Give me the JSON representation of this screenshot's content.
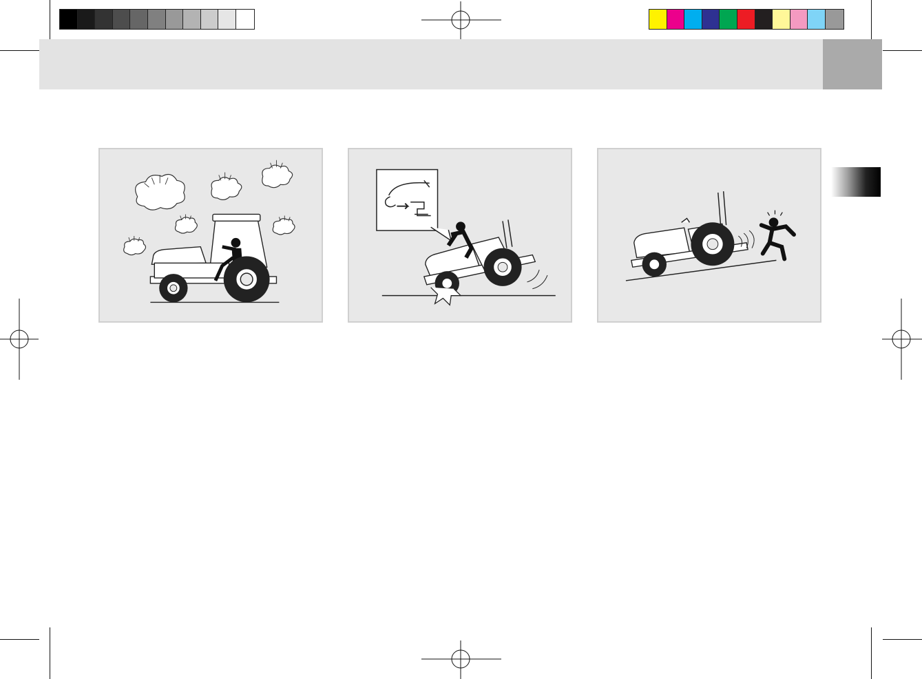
{
  "registration": {
    "gray_swatches": [
      "#000000",
      "#1a1a1a",
      "#333333",
      "#4d4d4d",
      "#666666",
      "#808080",
      "#999999",
      "#b3b3b3",
      "#cccccc",
      "#e6e6e6",
      "#ffffff"
    ],
    "color_swatches": [
      "#fff200",
      "#ec008c",
      "#00aeef",
      "#2e3192",
      "#00a651",
      "#ed1c24",
      "#231f20",
      "#fff799",
      "#f49ac1",
      "#7fd4f7",
      "#999999"
    ]
  },
  "header": {
    "band_color": "#e3e3e3",
    "tab_color": "#aaaaaa"
  },
  "illustrations": [
    {
      "name": "tractor-in-storm",
      "icon": "tractor-lightning-icon"
    },
    {
      "name": "tractor-tipping-forward",
      "icon": "tractor-rollover-icon"
    },
    {
      "name": "tractor-on-slope-operator-fleeing",
      "icon": "tractor-slope-icon"
    }
  ]
}
